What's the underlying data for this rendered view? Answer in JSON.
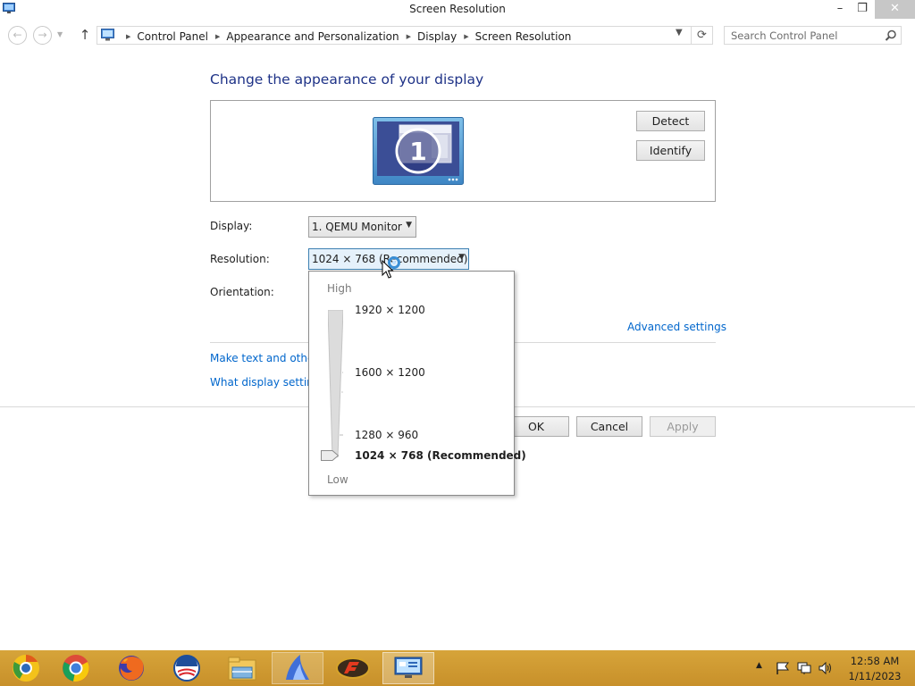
{
  "window": {
    "title": "Screen Resolution",
    "minimize": "–",
    "maximize": "❐",
    "close": "✕"
  },
  "address_bar": {
    "breadcrumbs": [
      "Control Panel",
      "Appearance and Personalization",
      "Display",
      "Screen Resolution"
    ],
    "separator": "▶",
    "search_placeholder": "Search Control Panel"
  },
  "main": {
    "heading": "Change the appearance of your display",
    "monitor_number": "1",
    "detect_label": "Detect",
    "identify_label": "Identify",
    "display_label": "Display:",
    "display_value": "1. QEMU Monitor",
    "resolution_label": "Resolution:",
    "resolution_value": "1024 × 768 (Recommended)",
    "orientation_label": "Orientation:",
    "advanced_settings": "Advanced settings",
    "make_text_link": "Make text and other",
    "what_display_link": "What display settin",
    "ok_label": "OK",
    "cancel_label": "Cancel",
    "apply_label": "Apply"
  },
  "resolution_popup": {
    "high_label": "High",
    "low_label": "Low",
    "options": [
      "1920 × 1200",
      "1600 × 1200",
      "1280 × 960",
      "1024 × 768 (Recommended)"
    ],
    "selected_index": 3
  },
  "taskbar": {
    "apps": [
      "chrome-canary-icon",
      "chrome-icon",
      "firefox-icon",
      "obama-logo-icon",
      "file-explorer-icon",
      "shark-app-icon",
      "crossfire-icon",
      "control-panel-icon"
    ],
    "clock_time": "12:58 AM",
    "clock_date": "1/11/2023"
  },
  "colors": {
    "heading": "#1e3287",
    "link": "#0066cc",
    "taskbar": "#c8902a"
  }
}
